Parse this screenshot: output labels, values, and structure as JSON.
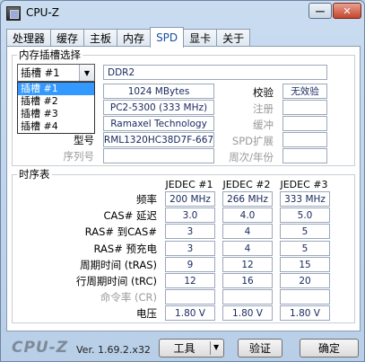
{
  "window": {
    "title": "CPU-Z",
    "minimize_label": "—",
    "close_label": "✕"
  },
  "tabs": [
    "处理器",
    "缓存",
    "主板",
    "内存",
    "SPD",
    "显卡",
    "关于"
  ],
  "active_tab": "SPD",
  "slot_group": {
    "title": "内存插槽选择",
    "selected": "插槽 #1",
    "options": [
      "插槽 #1",
      "插槽 #2",
      "插槽 #3",
      "插槽 #4"
    ],
    "memory_type": "DDR2",
    "module_size": "1024 MBytes",
    "max_bandwidth": "PC2-5300 (333 MHz)",
    "manufacturer": "Ramaxel Technology",
    "part_number": "RML1320HC38D7F-667",
    "serial_number": "",
    "labels": {
      "part_number": "型号",
      "serial_number": "序列号",
      "correction": "校验",
      "registered": "注册",
      "buffered": "缓冲",
      "spd_ext": "SPD扩展",
      "week_year": "周次/年份"
    },
    "correction_value": "无效验",
    "registered_value": "",
    "buffered_value": "",
    "spd_ext_value": "",
    "week_year_value": ""
  },
  "timing": {
    "title": "时序表",
    "columns": [
      "JEDEC #1",
      "JEDEC #2",
      "JEDEC #3"
    ],
    "rows": [
      {
        "label": "频率",
        "values": [
          "200 MHz",
          "266 MHz",
          "333 MHz"
        ],
        "disabled": false
      },
      {
        "label": "CAS# 延迟",
        "values": [
          "3.0",
          "4.0",
          "5.0"
        ],
        "disabled": false
      },
      {
        "label": "RAS# 到CAS#",
        "values": [
          "3",
          "4",
          "5"
        ],
        "disabled": false
      },
      {
        "label": "RAS# 预充电",
        "values": [
          "3",
          "4",
          "5"
        ],
        "disabled": false
      },
      {
        "label": "周期时间 (tRAS)",
        "values": [
          "9",
          "12",
          "15"
        ],
        "disabled": false
      },
      {
        "label": "行周期时间 (tRC)",
        "values": [
          "12",
          "16",
          "20"
        ],
        "disabled": false
      },
      {
        "label": "命令率 (CR)",
        "values": [
          "",
          "",
          ""
        ],
        "disabled": true
      },
      {
        "label": "电压",
        "values": [
          "1.80 V",
          "1.80 V",
          "1.80 V"
        ],
        "disabled": false
      }
    ]
  },
  "footer": {
    "logo": "CPU-Z",
    "version": "Ver. 1.69.2.x32",
    "tools_label": "工具",
    "validate_label": "验证",
    "ok_label": "确定"
  }
}
